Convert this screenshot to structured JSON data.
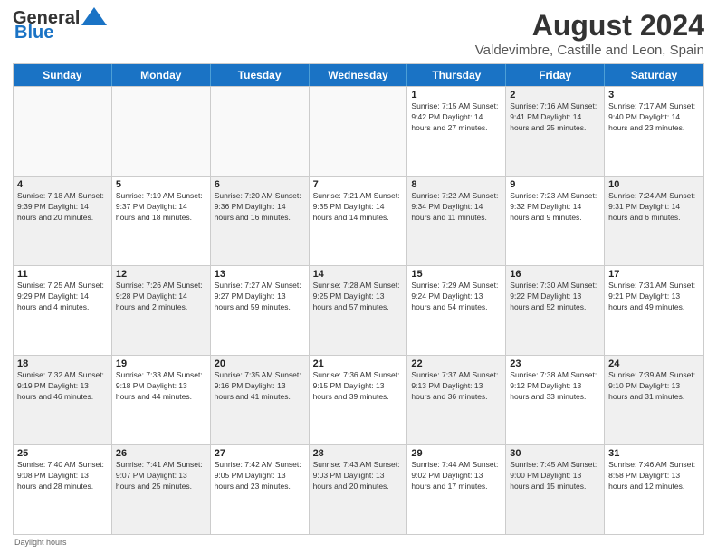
{
  "header": {
    "logo_line1": "General",
    "logo_line2": "Blue",
    "title": "August 2024",
    "subtitle": "Valdevimbre, Castille and Leon, Spain"
  },
  "weekdays": [
    "Sunday",
    "Monday",
    "Tuesday",
    "Wednesday",
    "Thursday",
    "Friday",
    "Saturday"
  ],
  "rows": [
    [
      {
        "day": "",
        "text": "",
        "empty": true
      },
      {
        "day": "",
        "text": "",
        "empty": true
      },
      {
        "day": "",
        "text": "",
        "empty": true
      },
      {
        "day": "",
        "text": "",
        "empty": true
      },
      {
        "day": "1",
        "text": "Sunrise: 7:15 AM\nSunset: 9:42 PM\nDaylight: 14 hours and 27 minutes.",
        "shaded": false
      },
      {
        "day": "2",
        "text": "Sunrise: 7:16 AM\nSunset: 9:41 PM\nDaylight: 14 hours and 25 minutes.",
        "shaded": true
      },
      {
        "day": "3",
        "text": "Sunrise: 7:17 AM\nSunset: 9:40 PM\nDaylight: 14 hours and 23 minutes.",
        "shaded": false
      }
    ],
    [
      {
        "day": "4",
        "text": "Sunrise: 7:18 AM\nSunset: 9:39 PM\nDaylight: 14 hours and 20 minutes.",
        "shaded": true
      },
      {
        "day": "5",
        "text": "Sunrise: 7:19 AM\nSunset: 9:37 PM\nDaylight: 14 hours and 18 minutes.",
        "shaded": false
      },
      {
        "day": "6",
        "text": "Sunrise: 7:20 AM\nSunset: 9:36 PM\nDaylight: 14 hours and 16 minutes.",
        "shaded": true
      },
      {
        "day": "7",
        "text": "Sunrise: 7:21 AM\nSunset: 9:35 PM\nDaylight: 14 hours and 14 minutes.",
        "shaded": false
      },
      {
        "day": "8",
        "text": "Sunrise: 7:22 AM\nSunset: 9:34 PM\nDaylight: 14 hours and 11 minutes.",
        "shaded": true
      },
      {
        "day": "9",
        "text": "Sunrise: 7:23 AM\nSunset: 9:32 PM\nDaylight: 14 hours and 9 minutes.",
        "shaded": false
      },
      {
        "day": "10",
        "text": "Sunrise: 7:24 AM\nSunset: 9:31 PM\nDaylight: 14 hours and 6 minutes.",
        "shaded": true
      }
    ],
    [
      {
        "day": "11",
        "text": "Sunrise: 7:25 AM\nSunset: 9:29 PM\nDaylight: 14 hours and 4 minutes.",
        "shaded": false
      },
      {
        "day": "12",
        "text": "Sunrise: 7:26 AM\nSunset: 9:28 PM\nDaylight: 14 hours and 2 minutes.",
        "shaded": true
      },
      {
        "day": "13",
        "text": "Sunrise: 7:27 AM\nSunset: 9:27 PM\nDaylight: 13 hours and 59 minutes.",
        "shaded": false
      },
      {
        "day": "14",
        "text": "Sunrise: 7:28 AM\nSunset: 9:25 PM\nDaylight: 13 hours and 57 minutes.",
        "shaded": true
      },
      {
        "day": "15",
        "text": "Sunrise: 7:29 AM\nSunset: 9:24 PM\nDaylight: 13 hours and 54 minutes.",
        "shaded": false
      },
      {
        "day": "16",
        "text": "Sunrise: 7:30 AM\nSunset: 9:22 PM\nDaylight: 13 hours and 52 minutes.",
        "shaded": true
      },
      {
        "day": "17",
        "text": "Sunrise: 7:31 AM\nSunset: 9:21 PM\nDaylight: 13 hours and 49 minutes.",
        "shaded": false
      }
    ],
    [
      {
        "day": "18",
        "text": "Sunrise: 7:32 AM\nSunset: 9:19 PM\nDaylight: 13 hours and 46 minutes.",
        "shaded": true
      },
      {
        "day": "19",
        "text": "Sunrise: 7:33 AM\nSunset: 9:18 PM\nDaylight: 13 hours and 44 minutes.",
        "shaded": false
      },
      {
        "day": "20",
        "text": "Sunrise: 7:35 AM\nSunset: 9:16 PM\nDaylight: 13 hours and 41 minutes.",
        "shaded": true
      },
      {
        "day": "21",
        "text": "Sunrise: 7:36 AM\nSunset: 9:15 PM\nDaylight: 13 hours and 39 minutes.",
        "shaded": false
      },
      {
        "day": "22",
        "text": "Sunrise: 7:37 AM\nSunset: 9:13 PM\nDaylight: 13 hours and 36 minutes.",
        "shaded": true
      },
      {
        "day": "23",
        "text": "Sunrise: 7:38 AM\nSunset: 9:12 PM\nDaylight: 13 hours and 33 minutes.",
        "shaded": false
      },
      {
        "day": "24",
        "text": "Sunrise: 7:39 AM\nSunset: 9:10 PM\nDaylight: 13 hours and 31 minutes.",
        "shaded": true
      }
    ],
    [
      {
        "day": "25",
        "text": "Sunrise: 7:40 AM\nSunset: 9:08 PM\nDaylight: 13 hours and 28 minutes.",
        "shaded": false
      },
      {
        "day": "26",
        "text": "Sunrise: 7:41 AM\nSunset: 9:07 PM\nDaylight: 13 hours and 25 minutes.",
        "shaded": true
      },
      {
        "day": "27",
        "text": "Sunrise: 7:42 AM\nSunset: 9:05 PM\nDaylight: 13 hours and 23 minutes.",
        "shaded": false
      },
      {
        "day": "28",
        "text": "Sunrise: 7:43 AM\nSunset: 9:03 PM\nDaylight: 13 hours and 20 minutes.",
        "shaded": true
      },
      {
        "day": "29",
        "text": "Sunrise: 7:44 AM\nSunset: 9:02 PM\nDaylight: 13 hours and 17 minutes.",
        "shaded": false
      },
      {
        "day": "30",
        "text": "Sunrise: 7:45 AM\nSunset: 9:00 PM\nDaylight: 13 hours and 15 minutes.",
        "shaded": true
      },
      {
        "day": "31",
        "text": "Sunrise: 7:46 AM\nSunset: 8:58 PM\nDaylight: 13 hours and 12 minutes.",
        "shaded": false
      }
    ]
  ],
  "footer": {
    "note": "Daylight hours"
  }
}
